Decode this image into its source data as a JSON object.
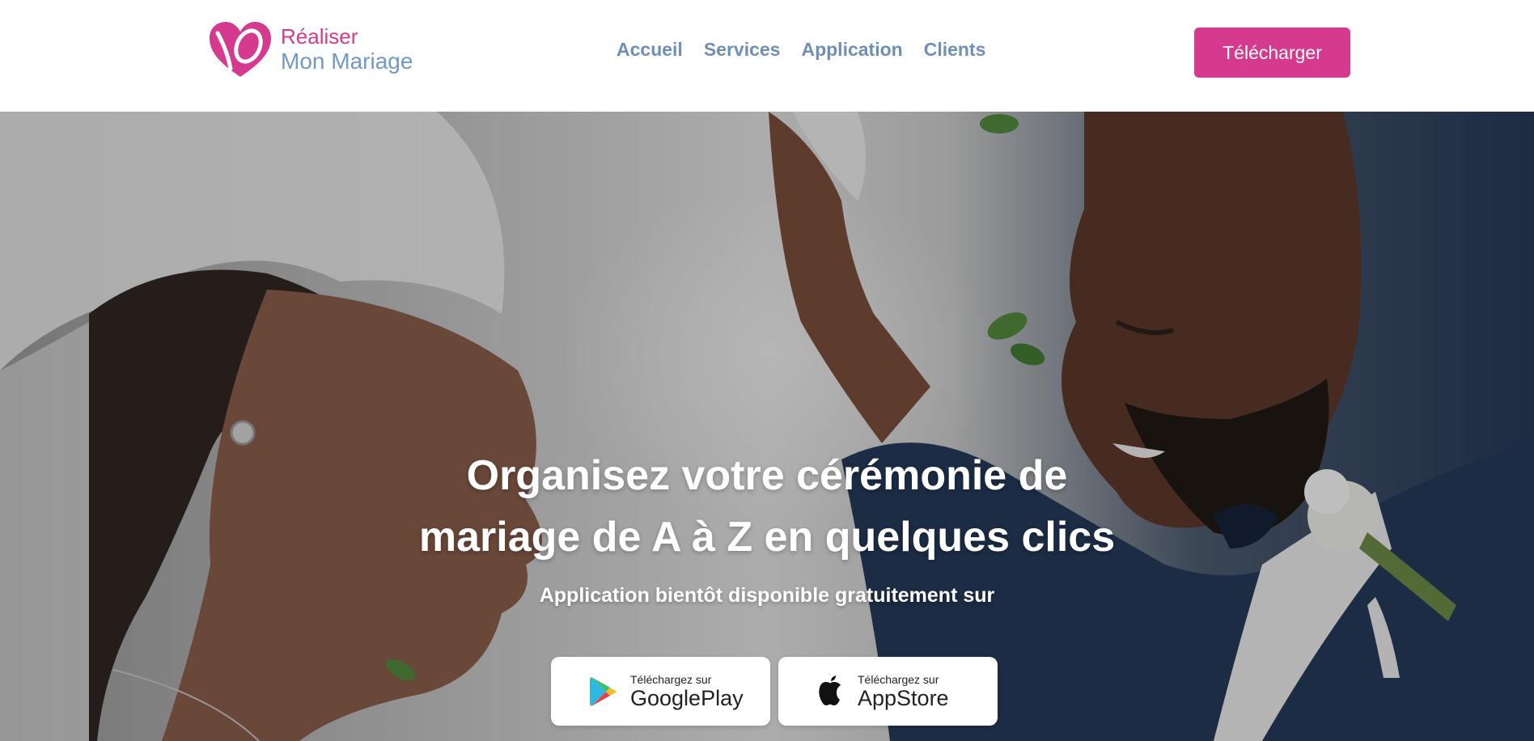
{
  "brand": {
    "line1": "Réaliser",
    "line2": "Mon Mariage",
    "primary_color": "#d63a8f",
    "secondary_color": "#6f99c6"
  },
  "nav": {
    "items": [
      {
        "label": "Accueil"
      },
      {
        "label": "Services"
      },
      {
        "label": "Application"
      },
      {
        "label": "Clients"
      }
    ]
  },
  "header": {
    "cta_label": "Télécharger"
  },
  "hero": {
    "title_line1": "Organisez votre cérémonie de",
    "title_line2": "mariage de A à Z en quelques clics",
    "subtitle": "Application bientôt disponible gratuitement sur",
    "photo": "wedding-couple-photo"
  },
  "stores": [
    {
      "small": "Téléchargez sur",
      "big": "GooglePlay",
      "icon": "google-play-icon"
    },
    {
      "small": "Téléchargez sur",
      "big": "AppStore",
      "icon": "apple-icon"
    }
  ]
}
